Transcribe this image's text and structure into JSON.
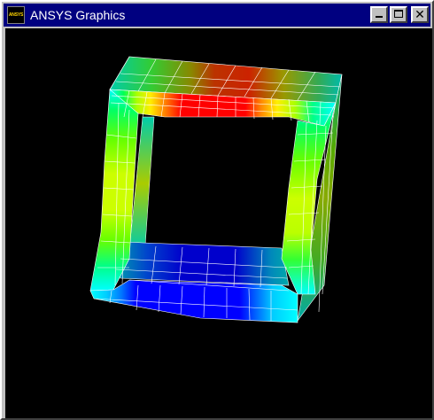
{
  "window": {
    "title": "ANSYS Graphics",
    "icon_text": "ANSYS",
    "icon_name": "ansys-app-icon",
    "controls": {
      "minimize_icon": "minimize-icon",
      "maximize_icon": "maximize-icon",
      "close_icon": "close-icon",
      "close_glyph": "✕"
    }
  },
  "viewport": {
    "background": "#000000",
    "model_description": "3D square tube finite element mesh with stress contour colors",
    "contour_colors": [
      "#0000ff",
      "#00aaff",
      "#00ffff",
      "#00ff88",
      "#66ff00",
      "#ccff00",
      "#ffcc00",
      "#ff8800",
      "#ff0000"
    ]
  }
}
